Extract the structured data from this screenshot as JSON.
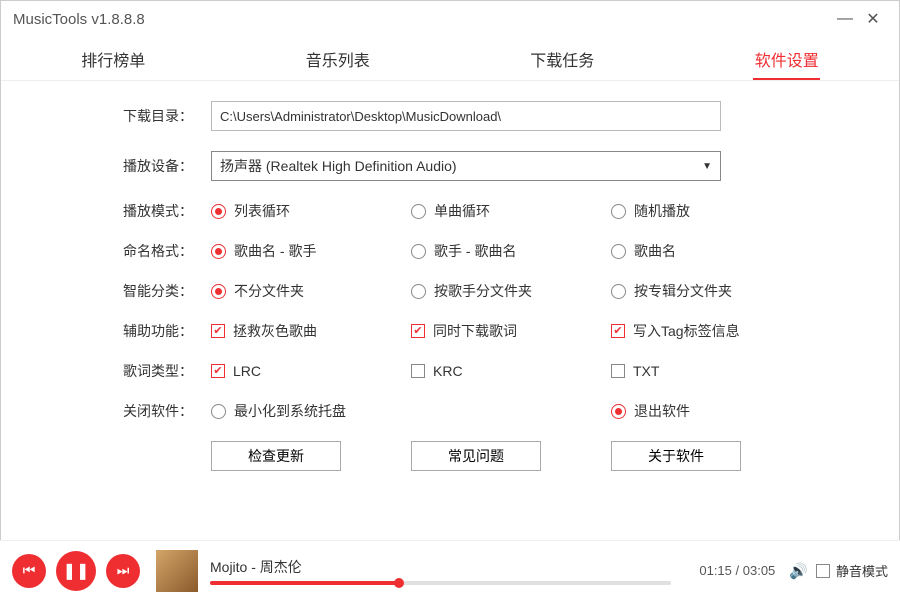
{
  "window": {
    "title": "MusicTools v1.8.8.8"
  },
  "tabs": [
    "排行榜单",
    "音乐列表",
    "下载任务",
    "软件设置"
  ],
  "activeTab": 3,
  "settings": {
    "downloadDir": {
      "label": "下载目录：",
      "value": "C:\\Users\\Administrator\\Desktop\\MusicDownload\\"
    },
    "playDevice": {
      "label": "播放设备：",
      "value": "扬声器 (Realtek High Definition Audio)"
    },
    "playMode": {
      "label": "播放模式：",
      "options": [
        "列表循环",
        "单曲循环",
        "随机播放"
      ],
      "selected": 0
    },
    "nameFormat": {
      "label": "命名格式：",
      "options": [
        "歌曲名 - 歌手",
        "歌手 - 歌曲名",
        "歌曲名"
      ],
      "selected": 0
    },
    "smartSort": {
      "label": "智能分类：",
      "options": [
        "不分文件夹",
        "按歌手分文件夹",
        "按专辑分文件夹"
      ],
      "selected": 0
    },
    "aux": {
      "label": "辅助功能：",
      "options": [
        "拯救灰色歌曲",
        "同时下载歌词",
        "写入Tag标签信息"
      ],
      "checked": [
        true,
        true,
        true
      ]
    },
    "lyricType": {
      "label": "歌词类型：",
      "options": [
        "LRC",
        "KRC",
        "TXT"
      ],
      "checked": [
        true,
        false,
        false
      ]
    },
    "onClose": {
      "label": "关闭软件：",
      "options": [
        "最小化到系统托盘",
        "退出软件"
      ],
      "selected": 1
    }
  },
  "buttons": {
    "checkUpdate": "检查更新",
    "faq": "常见问题",
    "about": "关于软件"
  },
  "player": {
    "track": "Mojito - 周杰伦",
    "elapsed": "01:15",
    "total": "03:05",
    "mute": "静音模式"
  }
}
